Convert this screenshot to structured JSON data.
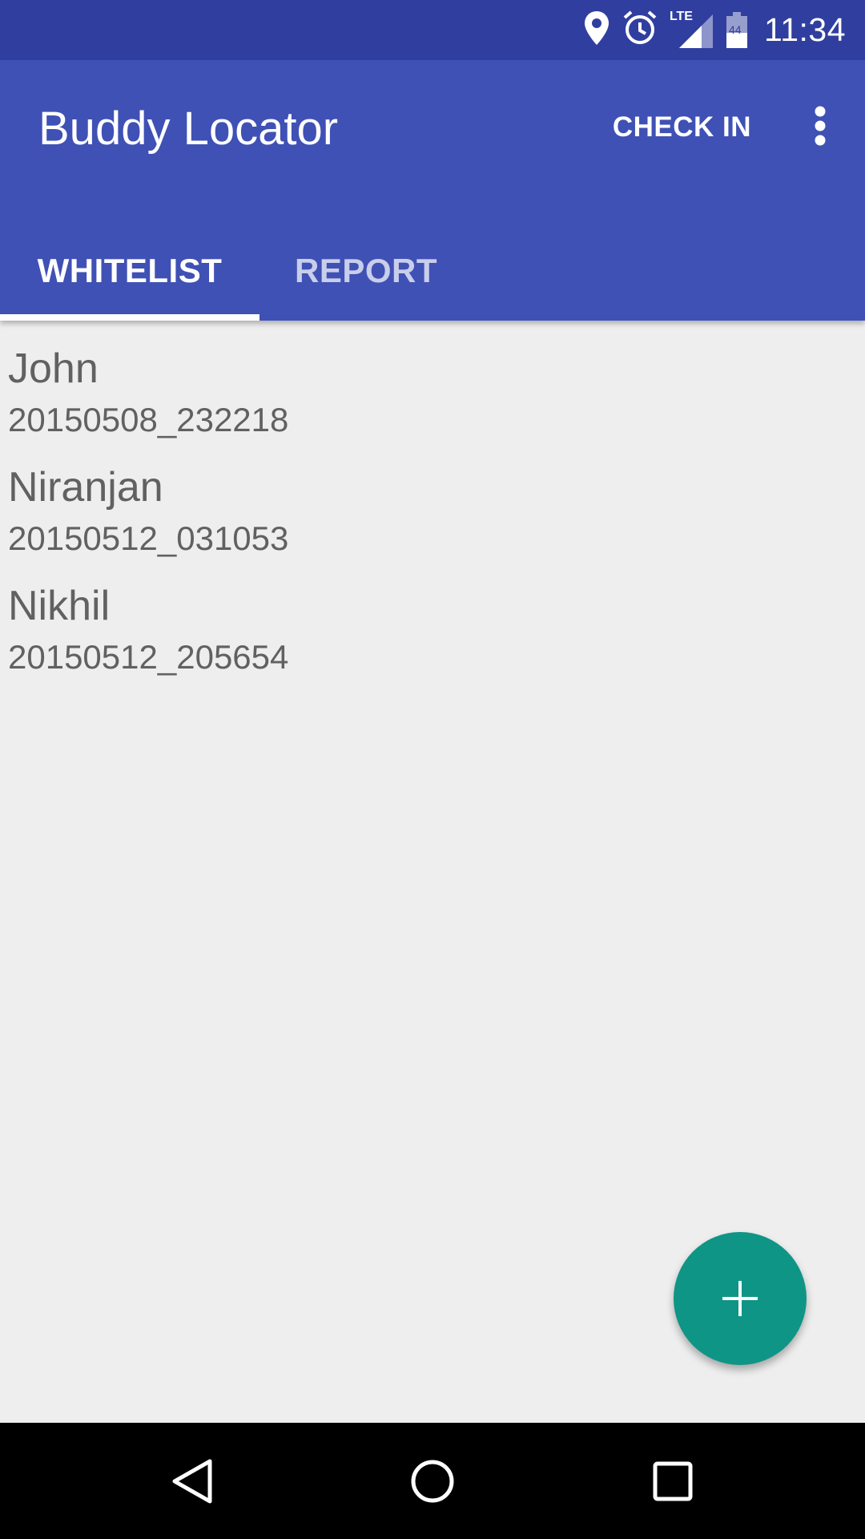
{
  "status_bar": {
    "time": "11:34",
    "icons": [
      "location-icon",
      "alarm-icon",
      "lte-signal-icon",
      "battery-icon"
    ],
    "lte_label": "LTE",
    "battery_level": "44"
  },
  "app_bar": {
    "title": "Buddy Locator",
    "check_in_label": "CHECK IN",
    "overflow_icon": "more-vert-icon"
  },
  "tabs": [
    {
      "label": "WHITELIST",
      "active": true
    },
    {
      "label": "REPORT",
      "active": false
    }
  ],
  "list": {
    "items": [
      {
        "name": "John",
        "timestamp": "20150508_232218"
      },
      {
        "name": "Niranjan",
        "timestamp": "20150512_031053"
      },
      {
        "name": "Nikhil",
        "timestamp": "20150512_205654"
      }
    ]
  },
  "fab": {
    "icon": "plus-icon"
  },
  "nav_bar": {
    "icons": [
      "back-icon",
      "home-icon",
      "recents-icon"
    ]
  },
  "colors": {
    "primary": "#3f51b5",
    "primary_dark": "#303f9f",
    "accent": "#0e9586",
    "background": "#eeeeee",
    "text_secondary": "#616161"
  }
}
